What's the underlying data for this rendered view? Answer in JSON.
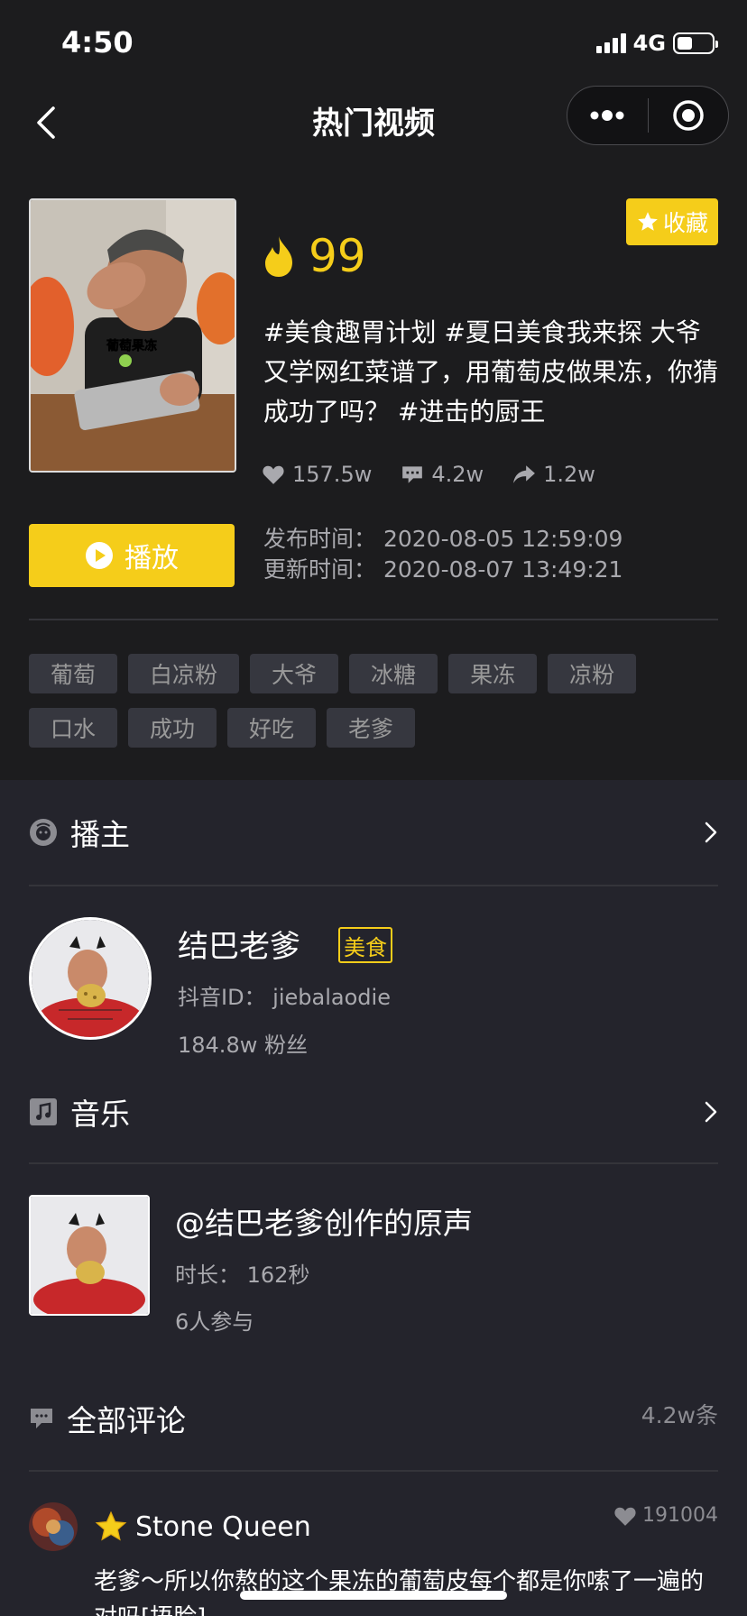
{
  "status_bar": {
    "time": "4:50",
    "network": "4G",
    "battery_level": 0.45
  },
  "nav": {
    "title": "热门视频"
  },
  "video": {
    "favorite_label": "收藏",
    "hot_value": "99",
    "description": "#美食趣胃计划 #夏日美食我来探 大爷又学网红菜谱了，用葡萄皮做果冻，你猜成功了吗？ #进击的厨王",
    "thumbnail_caption": "葡萄果冻",
    "likes": "157.5w",
    "comments": "4.2w",
    "shares": "1.2w",
    "play_label": "播放",
    "publish_time": "发布时间：  2020-08-05 12:59:09",
    "update_time": "更新时间：  2020-08-07 13:49:21",
    "tags": [
      "葡萄",
      "白凉粉",
      "大爷",
      "冰糖",
      "果冻",
      "凉粉",
      "口水",
      "成功",
      "好吃",
      "老爹"
    ]
  },
  "anchor": {
    "section_label": "播主",
    "name": "结巴老爹",
    "badge": "美食",
    "douyin_id": "抖音ID：  jiebalaodie",
    "fans": "184.8w 粉丝"
  },
  "music": {
    "section_label": "音乐",
    "title": "@结巴老爹创作的原声",
    "duration": "时长：  162秒",
    "participants": "6人参与"
  },
  "comments": {
    "section_label": "全部评论",
    "count": "4.2w条",
    "items": [
      {
        "user": "Stone Queen",
        "likes": "191004",
        "text": "老爹～所以你熬的这个果冻的葡萄皮每个都是你嗦了一遍的对吗[捂脸]"
      }
    ]
  },
  "colors": {
    "accent": "#f5cd1a",
    "background": "#24242c",
    "header_bg": "#1c1c1e",
    "muted_text": "#a9a9ae"
  }
}
